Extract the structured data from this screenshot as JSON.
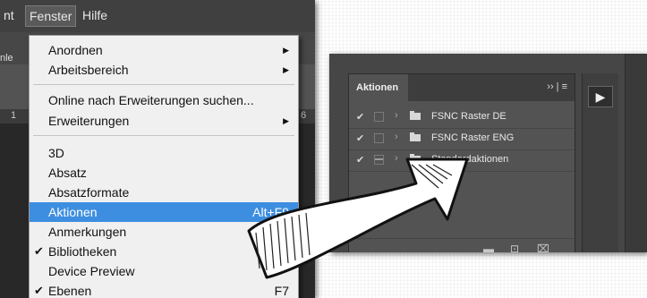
{
  "menubar": {
    "partial_item": "nt",
    "fenster": "Fenster",
    "hilfe": "Hilfe",
    "optbar_partial": "nle",
    "ruler_left": "1",
    "ruler_right": "6"
  },
  "menu": {
    "items": [
      {
        "label": "Anordnen",
        "submenu": true
      },
      {
        "label": "Arbeitsbereich",
        "submenu": true
      },
      {
        "label": "Online nach Erweiterungen suchen..."
      },
      {
        "label": "Erweiterungen",
        "submenu": true
      },
      {
        "label": "3D"
      },
      {
        "label": "Absatz"
      },
      {
        "label": "Absatzformate"
      },
      {
        "label": "Aktionen",
        "shortcut": "Alt+F9",
        "highlighted": true
      },
      {
        "label": "Anmerkungen"
      },
      {
        "label": "Bibliotheken",
        "checked": true
      },
      {
        "label": "Device Preview"
      },
      {
        "label": "Ebenen",
        "shortcut": "F7",
        "checked": true
      }
    ],
    "check_glyph": "✔",
    "arrow_glyph": "▶"
  },
  "panel": {
    "tab_label": "Aktionen",
    "menu_glyph": "›› | ≡",
    "rows": [
      {
        "name": "FSNC Raster DE",
        "checked": true,
        "dialog_toggle": false
      },
      {
        "name": "FSNC Raster ENG",
        "checked": true,
        "dialog_toggle": false
      },
      {
        "name": "Standardaktionen",
        "checked": true,
        "dialog_toggle": true
      }
    ],
    "row_check_glyph": "✔",
    "twisty_glyph": "›",
    "footer_icons": [
      "folder-icon",
      "new-item-icon",
      "trash-icon"
    ]
  },
  "side": {
    "play_glyph": "▶"
  },
  "colors": {
    "menu_highlight": "#3d8ee0",
    "panel_bg": "#535353",
    "menubar_bg": "#404040"
  }
}
